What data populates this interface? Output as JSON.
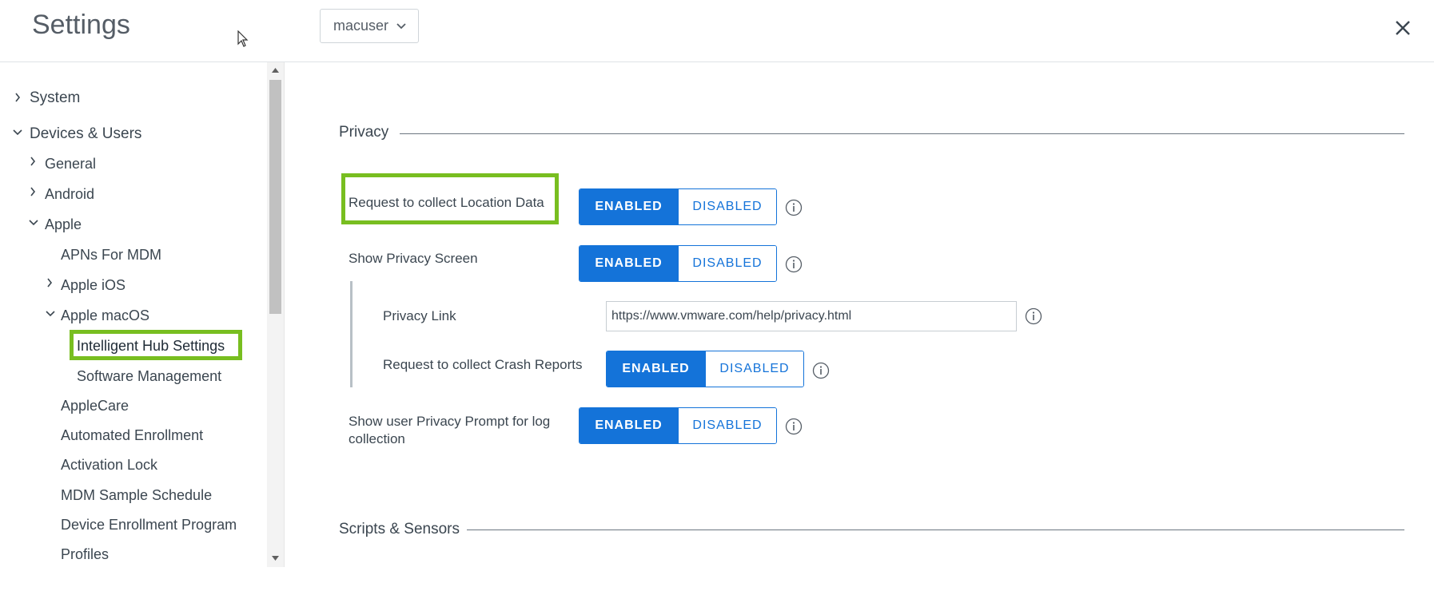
{
  "header": {
    "title": "Settings",
    "user_select": "macuser"
  },
  "sidebar": {
    "items": [
      {
        "label": "System"
      },
      {
        "label": "Devices & Users"
      },
      {
        "label": "General"
      },
      {
        "label": "Android"
      },
      {
        "label": "Apple"
      },
      {
        "label": "APNs For MDM"
      },
      {
        "label": "Apple iOS"
      },
      {
        "label": "Apple macOS"
      },
      {
        "label": "Intelligent Hub Settings"
      },
      {
        "label": "Software Management"
      },
      {
        "label": "AppleCare"
      },
      {
        "label": "Automated Enrollment"
      },
      {
        "label": "Activation Lock"
      },
      {
        "label": "MDM Sample Schedule"
      },
      {
        "label": "Device Enrollment Program"
      },
      {
        "label": "Profiles"
      }
    ]
  },
  "main": {
    "privacy_title": "Privacy",
    "scripts_title": "Scripts & Sensors",
    "fields": {
      "location": {
        "label": "Request to collect Location Data",
        "enabled": "ENABLED",
        "disabled": "DISABLED"
      },
      "privacy_screen": {
        "label": "Show Privacy Screen",
        "enabled": "ENABLED",
        "disabled": "DISABLED"
      },
      "privacy_link": {
        "label": "Privacy Link",
        "value": "https://www.vmware.com/help/privacy.html"
      },
      "crash_reports": {
        "label": "Request to collect Crash Reports",
        "enabled": "ENABLED",
        "disabled": "DISABLED"
      },
      "privacy_prompt": {
        "label": "Show user Privacy Prompt for log collection",
        "enabled": "ENABLED",
        "disabled": "DISABLED"
      }
    }
  },
  "colors": {
    "accent": "#1473d9",
    "highlight": "#78be20"
  }
}
